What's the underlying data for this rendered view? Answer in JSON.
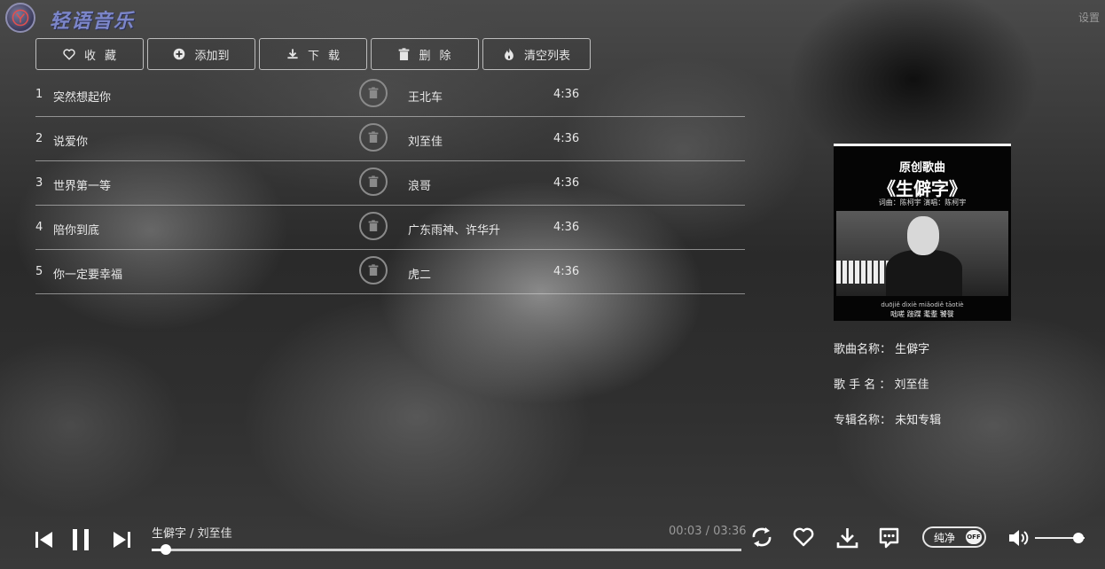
{
  "app": {
    "brand": "轻语音乐",
    "settings_label": "设置"
  },
  "toolbar": [
    {
      "label": "收藏",
      "icon": "heart-icon"
    },
    {
      "label": "添加到",
      "icon": "plus-circle-icon"
    },
    {
      "label": "下载",
      "icon": "download-icon"
    },
    {
      "label": "删除",
      "icon": "trash-icon"
    },
    {
      "label": "清空列表",
      "icon": "flame-icon"
    }
  ],
  "songs": [
    {
      "index": "1",
      "name": "突然想起你",
      "artist": "王北车",
      "duration": "4:36"
    },
    {
      "index": "2",
      "name": "说爱你",
      "artist": "刘至佳",
      "duration": "4:36"
    },
    {
      "index": "3",
      "name": "世界第一等",
      "artist": "浪哥",
      "duration": "4:36"
    },
    {
      "index": "4",
      "name": "陪你到底",
      "artist": "广东雨神、许华升",
      "duration": "4:36"
    },
    {
      "index": "5",
      "name": "你一定要幸福",
      "artist": "虎二",
      "duration": "4:36"
    }
  ],
  "album_cover": {
    "line1": "原创歌曲",
    "line2": "《生僻字》",
    "line3": "词曲：陈柯宇  演唱：陈柯宇",
    "line4": "duōjiě dìxiè miǎodiě tāotiè",
    "line5": "咄嗟 踥蹀 耄耋 饕餮"
  },
  "song_info": {
    "title_label": "歌曲名称：",
    "title_value": "生僻字",
    "singer_label": "歌 手 名 ：",
    "singer_value": "刘至佳",
    "album_label": "专辑名称：",
    "album_value": "未知专辑"
  },
  "player": {
    "now_playing": "生僻字 / 刘至佳",
    "time": "00:03 / 03:36",
    "progress": 0.024,
    "volume": 0.88,
    "pure_mode_label": "纯净",
    "pure_mode_state": "OFF"
  }
}
